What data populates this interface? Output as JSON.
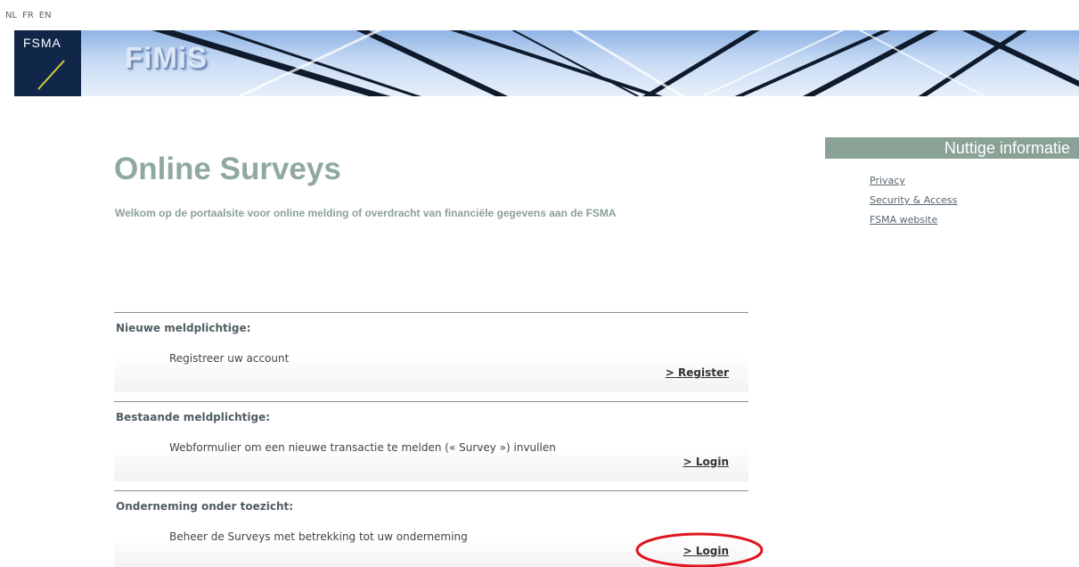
{
  "languages": [
    "NL",
    "FR",
    "EN"
  ],
  "logo": {
    "brand": "FSMA"
  },
  "app_title": "FiMiS",
  "page_title": "Online Surveys",
  "intro": "Welkom op de portaalsite voor online melding of overdracht van financiële gegevens aan de FSMA",
  "sections": [
    {
      "title": "Nieuwe meldplichtige:",
      "description": "Registreer uw account",
      "link": "> Register"
    },
    {
      "title": "Bestaande meldplichtige:",
      "description": "Webformulier om een nieuwe transactie te melden (« Survey ») invullen",
      "link": "> Login"
    },
    {
      "title": "Onderneming onder toezicht:",
      "description": "Beheer de Surveys met betrekking tot uw onderneming",
      "link": "> Login"
    }
  ],
  "sidebar": {
    "title": "Nuttige informatie",
    "links": [
      "Privacy",
      "Security & Access",
      "FSMA website"
    ]
  },
  "colors": {
    "accent_green": "#8aa196",
    "logo_navy": "#102749",
    "annotation_red": "#e0141e"
  }
}
